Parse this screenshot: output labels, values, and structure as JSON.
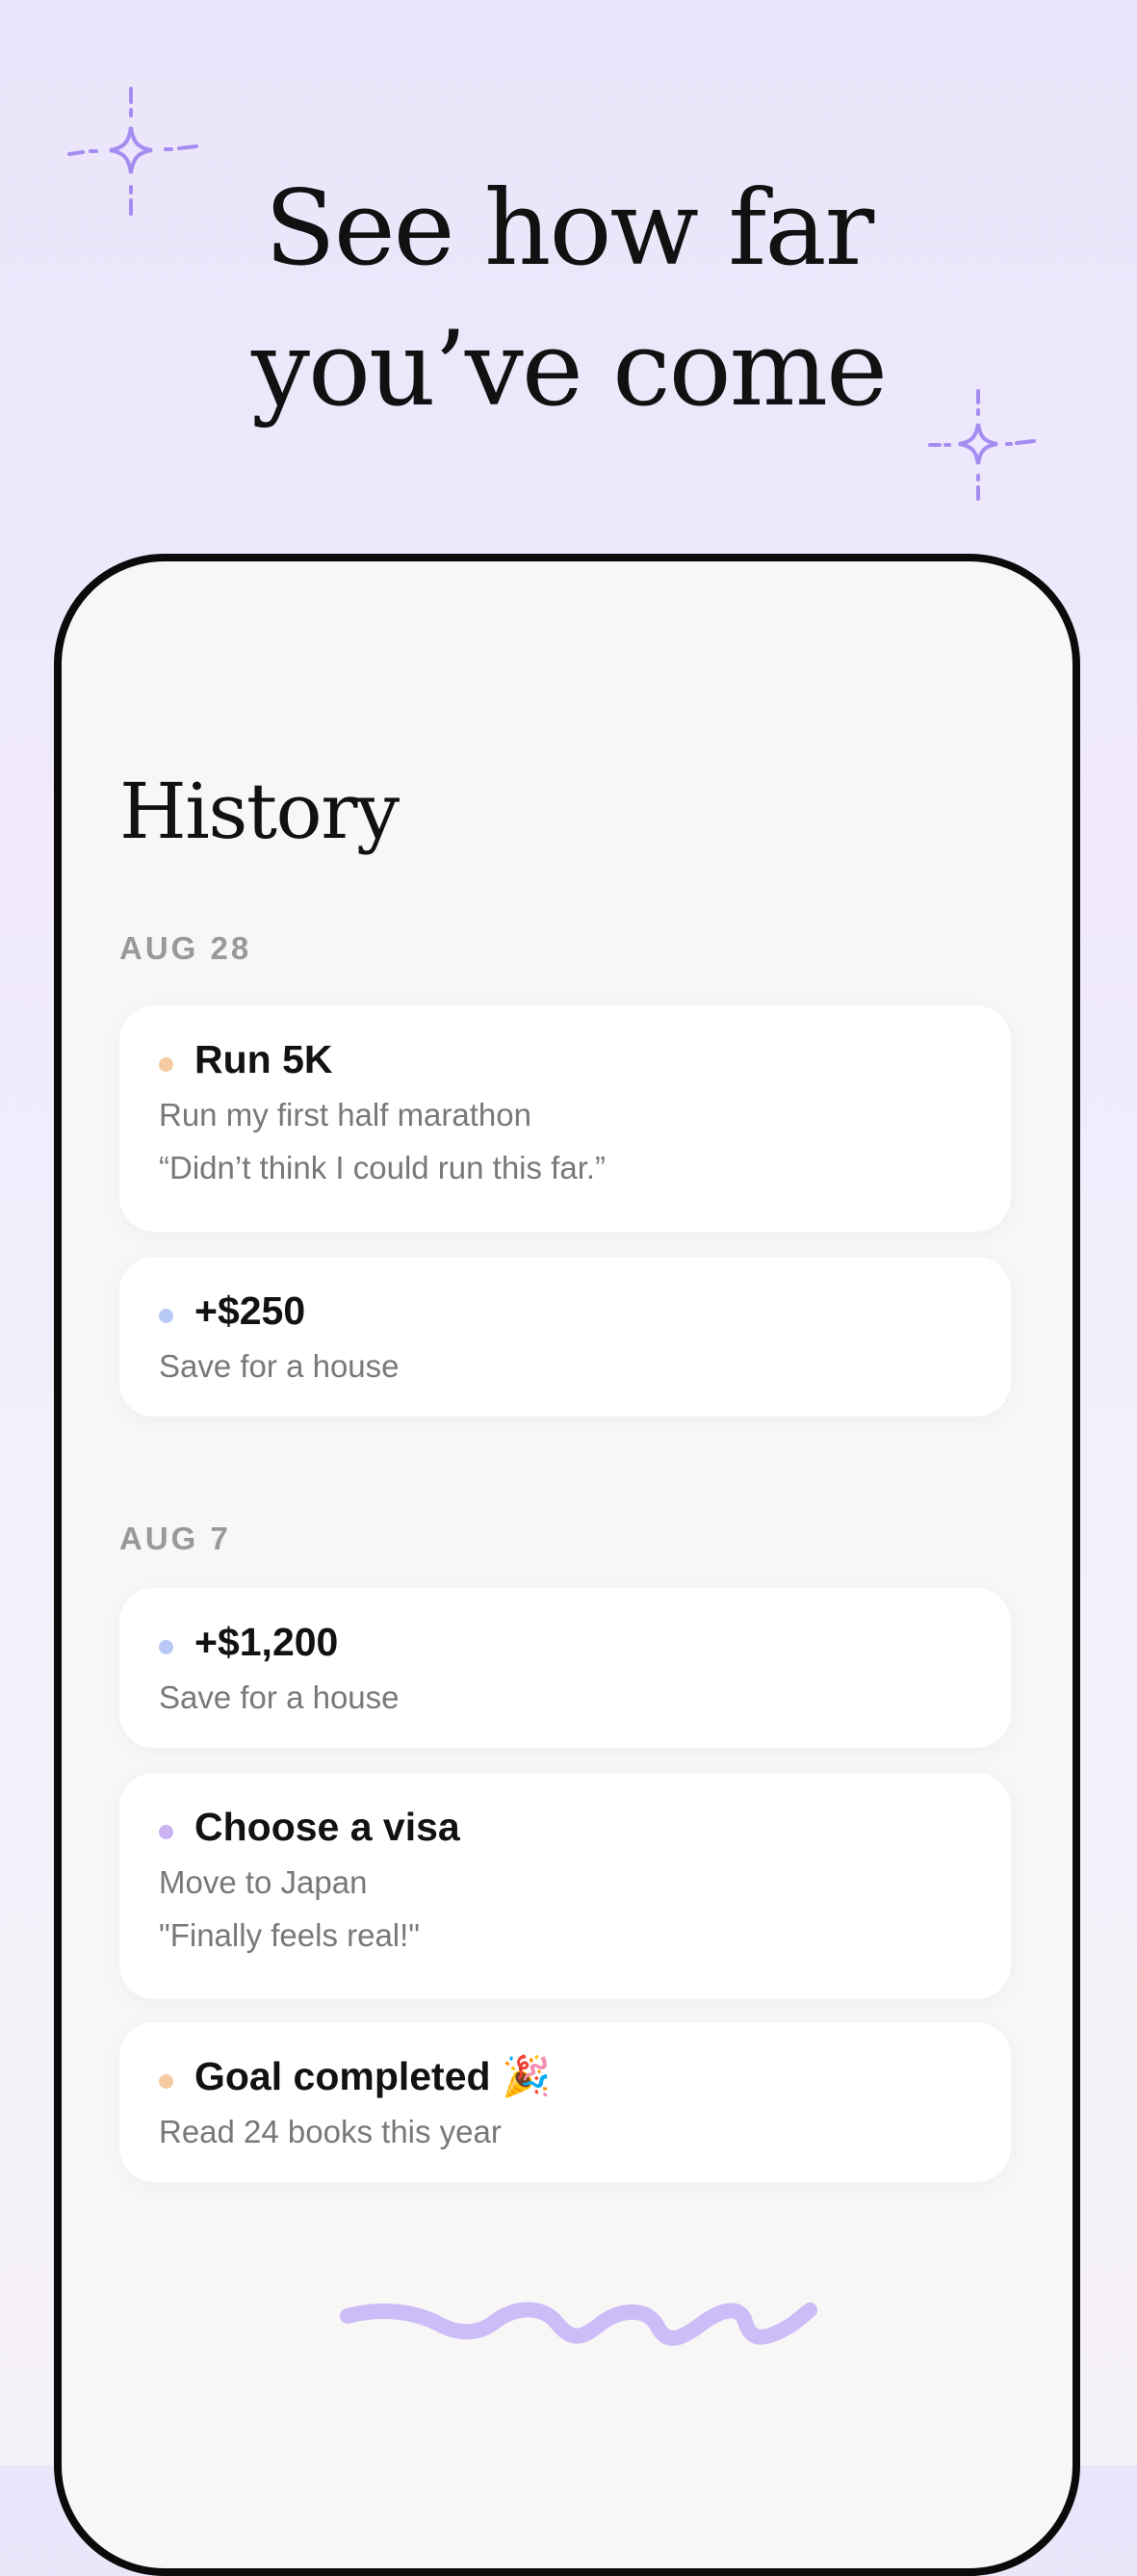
{
  "headline": {
    "line1": "See how far",
    "line2": "you’ve come"
  },
  "phone": {
    "title": "History",
    "groups": [
      {
        "date": "AUG 28",
        "entries": [
          {
            "title": "Run 5K",
            "goal": "Run my first half marathon",
            "note": "“Didn’t think I could run this far.”",
            "dot_color": "#f4cba3"
          },
          {
            "title": "+$250",
            "goal": "Save for a house",
            "dot_color": "#b8c9f5"
          }
        ]
      },
      {
        "date": "AUG 7",
        "entries": [
          {
            "title": "+$1,200",
            "goal": "Save for a house",
            "dot_color": "#b8c9f5"
          },
          {
            "title": "Choose a visa",
            "goal": "Move to Japan",
            "note": "\"Finally feels real!\"",
            "dot_color": "#c9b3f2"
          },
          {
            "title": "Goal completed 🎉",
            "goal": "Read 24 books this year",
            "dot_color": "#f4cba3"
          }
        ]
      }
    ]
  },
  "colors": {
    "accent_purple": "#a48df0",
    "squiggle": "#cbbdf7"
  },
  "icons": [
    "sparkle-icon",
    "squiggle-decoration"
  ]
}
